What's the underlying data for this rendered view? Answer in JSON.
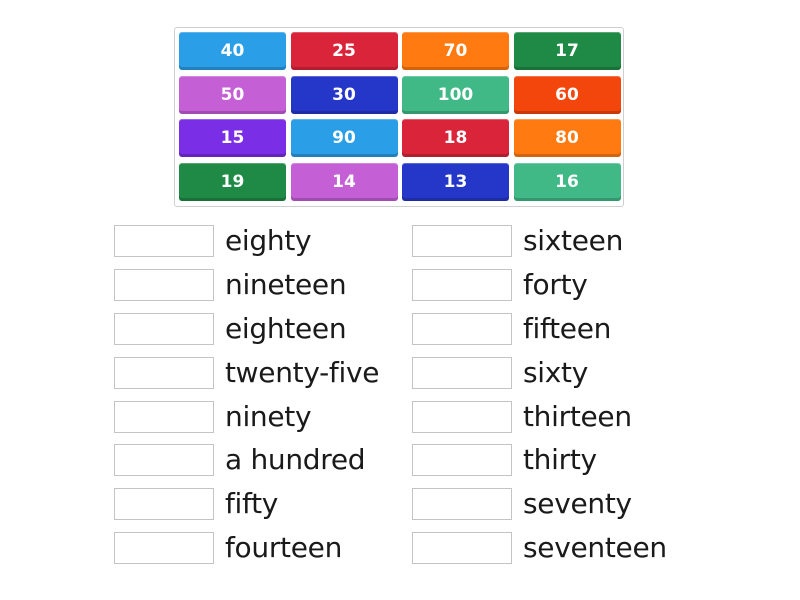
{
  "tiles": [
    {
      "label": "40",
      "color": "#2a9ee6"
    },
    {
      "label": "25",
      "color": "#d9243a"
    },
    {
      "label": "70",
      "color": "#ff7a10"
    },
    {
      "label": "17",
      "color": "#1f8a45"
    },
    {
      "label": "50",
      "color": "#c55fd6"
    },
    {
      "label": "30",
      "color": "#2537c8"
    },
    {
      "label": "100",
      "color": "#40b987"
    },
    {
      "label": "60",
      "color": "#f2460c"
    },
    {
      "label": "15",
      "color": "#7a2ee6"
    },
    {
      "label": "90",
      "color": "#2a9ee6"
    },
    {
      "label": "18",
      "color": "#d9243a"
    },
    {
      "label": "80",
      "color": "#ff7a10"
    },
    {
      "label": "19",
      "color": "#1f8a45"
    },
    {
      "label": "14",
      "color": "#c55fd6"
    },
    {
      "label": "13",
      "color": "#2537c8"
    },
    {
      "label": "16",
      "color": "#40b987"
    }
  ],
  "left_words": [
    "eighty",
    "nineteen",
    "eighteen",
    "twenty-five",
    "ninety",
    "a hundred",
    "fifty",
    "fourteen"
  ],
  "right_words": [
    "sixteen",
    "forty",
    "fifteen",
    "sixty",
    "thirteen",
    "thirty",
    "seventy",
    "seventeen"
  ]
}
